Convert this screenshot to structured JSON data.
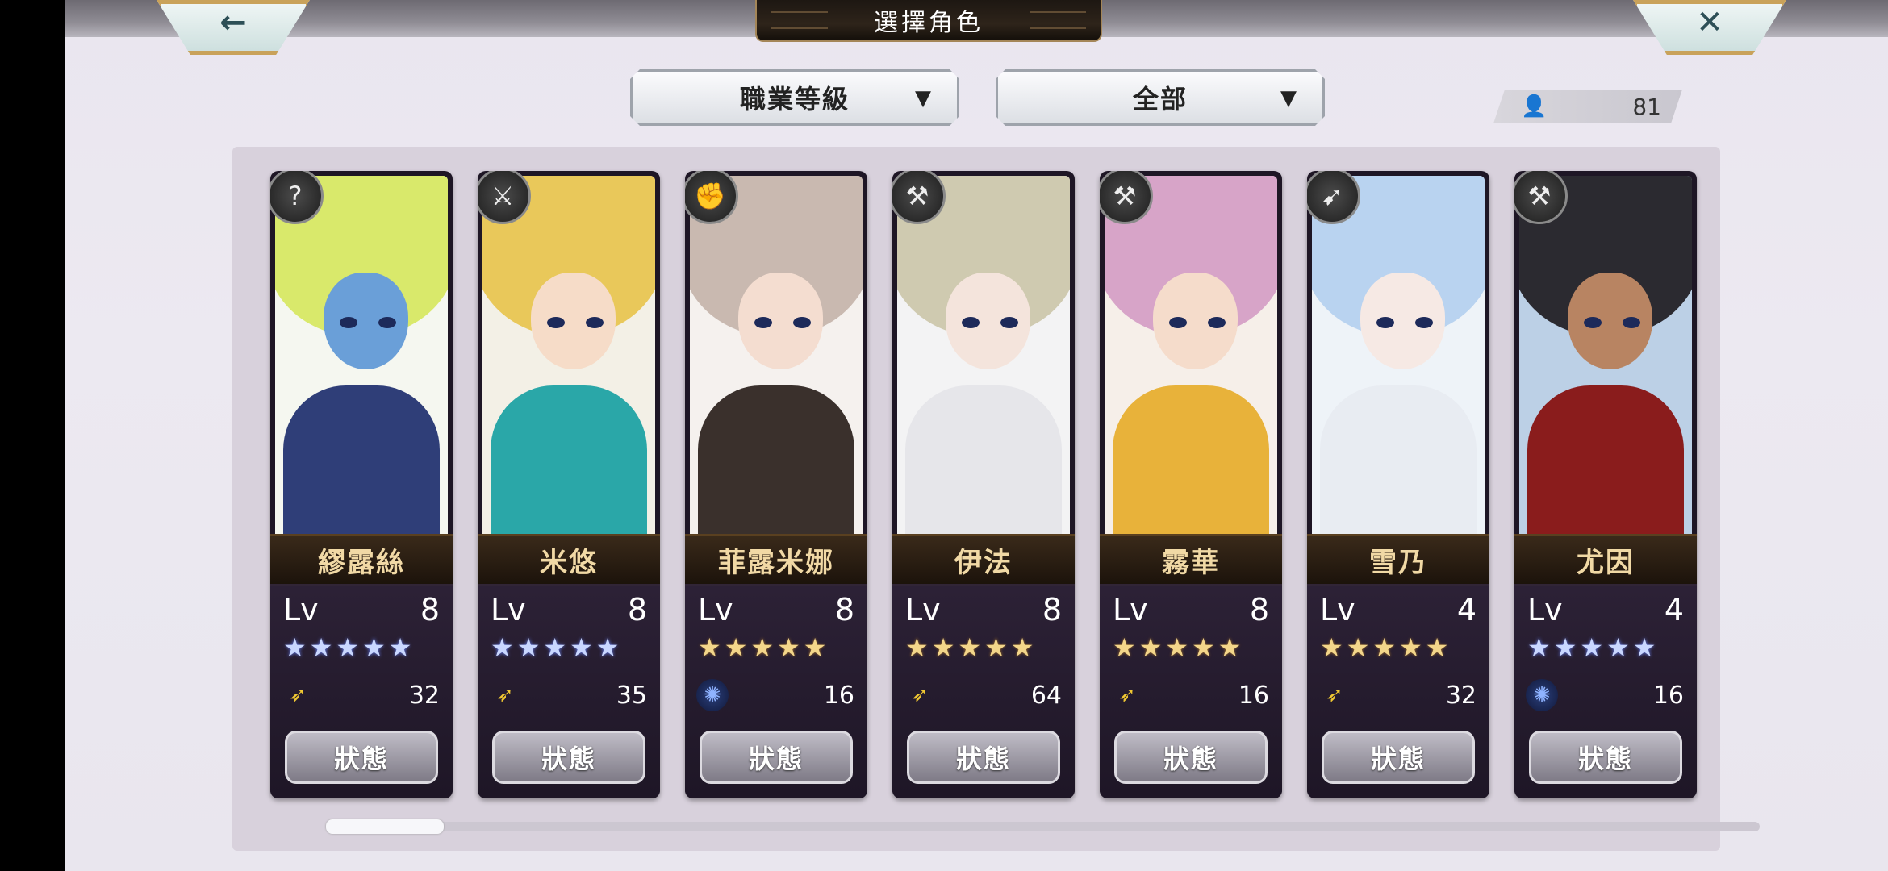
{
  "header": {
    "title": "選擇角色"
  },
  "nav": {
    "back_icon": "left-arrow-icon",
    "back_glyph": "←",
    "close_icon": "close-icon",
    "close_glyph": "✕"
  },
  "filters": {
    "sort": {
      "label": "職業等級",
      "arrow": "▼"
    },
    "group": {
      "label": "全部",
      "arrow": "▼"
    }
  },
  "character_count": {
    "icon": "person-icon",
    "icon_glyph": "👤",
    "value": "81"
  },
  "characters": [
    {
      "name": "繆露絲",
      "lv_label": "Lv",
      "level": "8",
      "stars": "★★★★★",
      "star_color": "blue",
      "element": "wind",
      "element_glyph": "➶",
      "power": "32",
      "status_label": "狀態",
      "job_glyph": "?"
    },
    {
      "name": "米悠",
      "lv_label": "Lv",
      "level": "8",
      "stars": "★★★★★",
      "star_color": "blue",
      "element": "wind",
      "element_glyph": "➶",
      "power": "35",
      "status_label": "狀態",
      "job_glyph": "⚔"
    },
    {
      "name": "菲露米娜",
      "lv_label": "Lv",
      "level": "8",
      "stars": "★★★★★",
      "star_color": "gold",
      "element": "swirl",
      "element_glyph": "✺",
      "power": "16",
      "status_label": "狀態",
      "job_glyph": "✊"
    },
    {
      "name": "伊法",
      "lv_label": "Lv",
      "level": "8",
      "stars": "★★★★★",
      "star_color": "gold",
      "element": "wind",
      "element_glyph": "➶",
      "power": "64",
      "status_label": "狀態",
      "job_glyph": "⚒"
    },
    {
      "name": "霧華",
      "lv_label": "Lv",
      "level": "8",
      "stars": "★★★★★",
      "star_color": "gold",
      "element": "wind",
      "element_glyph": "➶",
      "power": "16",
      "status_label": "狀態",
      "job_glyph": "⚒"
    },
    {
      "name": "雪乃",
      "lv_label": "Lv",
      "level": "4",
      "stars": "★★★★★",
      "star_color": "gold",
      "element": "wind",
      "element_glyph": "➶",
      "power": "32",
      "status_label": "狀態",
      "job_glyph": "➹"
    },
    {
      "name": "尤因",
      "lv_label": "Lv",
      "level": "4",
      "stars": "★★★★★",
      "star_color": "blue",
      "element": "swirl",
      "element_glyph": "✺",
      "power": "16",
      "status_label": "狀態",
      "job_glyph": "⚒"
    }
  ],
  "scroll": {
    "position": 0.0
  }
}
